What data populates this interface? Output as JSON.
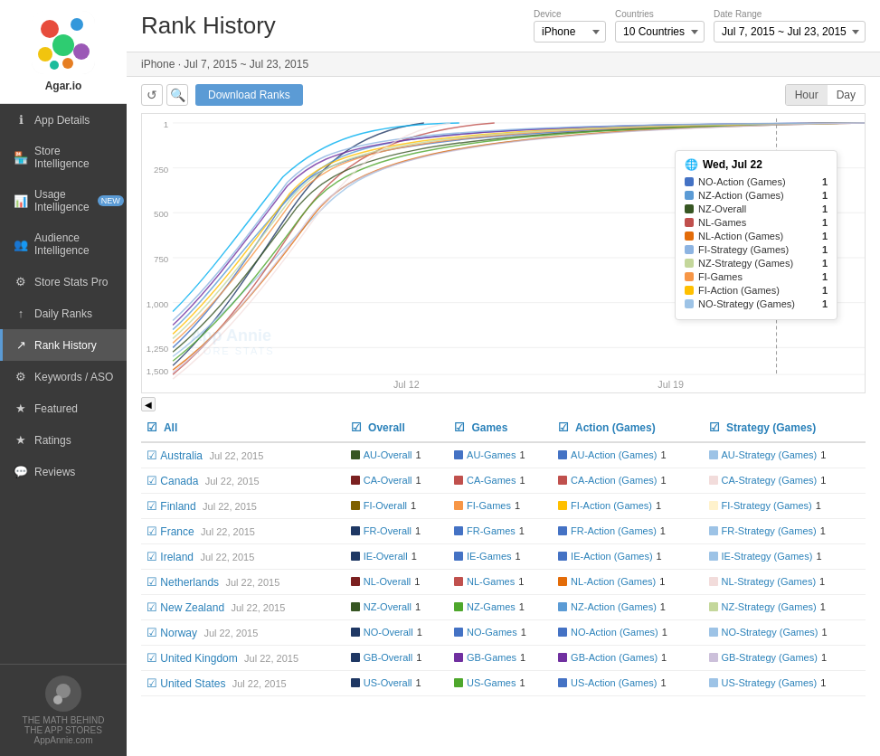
{
  "sidebar": {
    "app_name": "Agar.io",
    "nav_items": [
      {
        "id": "app-details",
        "label": "App Details",
        "icon": "ℹ",
        "badge": null,
        "active": false
      },
      {
        "id": "store-intelligence",
        "label": "Store Intelligence",
        "icon": "🏪",
        "badge": null,
        "active": false
      },
      {
        "id": "usage-intelligence",
        "label": "Usage Intelligence",
        "icon": "📊",
        "badge": "NEW",
        "active": false
      },
      {
        "id": "audience-intelligence",
        "label": "Audience Intelligence",
        "icon": "👥",
        "badge": null,
        "active": false
      },
      {
        "id": "store-stats-pro",
        "label": "Store Stats Pro",
        "icon": "⭐",
        "badge": null,
        "active": false
      },
      {
        "id": "daily-ranks",
        "label": "Daily Ranks",
        "icon": "📅",
        "badge": null,
        "active": false
      },
      {
        "id": "rank-history",
        "label": "Rank History",
        "icon": "📈",
        "badge": null,
        "active": true
      },
      {
        "id": "keywords",
        "label": "Keywords / ASO",
        "icon": "🔑",
        "badge": null,
        "active": false
      },
      {
        "id": "featured",
        "label": "Featured",
        "icon": "⭐",
        "badge": null,
        "active": false
      },
      {
        "id": "ratings",
        "label": "Ratings",
        "icon": "★",
        "badge": null,
        "active": false
      },
      {
        "id": "reviews",
        "label": "Reviews",
        "icon": "💬",
        "badge": null,
        "active": false
      }
    ],
    "footer_line1": "THE MATH BEHIND",
    "footer_line2": "THE APP STORES",
    "footer_line3": "AppAnnie.com"
  },
  "header": {
    "title": "Rank History",
    "device_label": "Device",
    "device_value": "iPhone",
    "countries_label": "Countries",
    "countries_value": "10 Countries",
    "date_label": "Date Range",
    "date_value": "Jul 7, 2015 ~ Jul 23, 2015"
  },
  "subheader": {
    "text": "iPhone · Jul 7, 2015 ~ Jul 23, 2015"
  },
  "chart": {
    "download_btn": "Download Ranks",
    "hour_btn": "Hour",
    "day_btn": "Day",
    "x_labels": [
      "Jul 12",
      "Jul 19"
    ],
    "y_labels": [
      "1",
      "250",
      "500",
      "750",
      "1,000",
      "1,250",
      "1,500"
    ],
    "tooltip": {
      "date": "Wed, Jul 22",
      "rows": [
        {
          "label": "NO-Action (Games)",
          "value": "1",
          "color": "#4472C4"
        },
        {
          "label": "NZ-Action (Games)",
          "value": "1",
          "color": "#5B9BD5"
        },
        {
          "label": "NZ-Overall",
          "value": "1",
          "color": "#375623"
        },
        {
          "label": "NL-Games",
          "value": "1",
          "color": "#C0504D"
        },
        {
          "label": "NL-Action (Games)",
          "value": "1",
          "color": "#E36C09"
        },
        {
          "label": "FI-Strategy (Games)",
          "value": "1",
          "color": "#8DB4E2"
        },
        {
          "label": "NZ-Strategy (Games)",
          "value": "1",
          "color": "#C4D79B"
        },
        {
          "label": "FI-Games",
          "value": "1",
          "color": "#F79646"
        },
        {
          "label": "FI-Action (Games)",
          "value": "1",
          "color": "#FFC000"
        },
        {
          "label": "NO-Strategy (Games)",
          "value": "1",
          "color": "#9DC3E6"
        }
      ]
    }
  },
  "table": {
    "headers": [
      "All",
      "Overall",
      "Games",
      "Action (Games)",
      "Strategy (Games)"
    ],
    "rows": [
      {
        "country": "Australia",
        "date": "Jul 22, 2015",
        "overall": {
          "label": "AU-Overall",
          "color": "#375623",
          "rank": "1"
        },
        "games": {
          "label": "AU-Games",
          "color": "#4472C4",
          "rank": "1"
        },
        "action": {
          "label": "AU-Action (Games)",
          "color": "#4472C4",
          "rank": "1"
        },
        "strategy": {
          "label": "AU-Strategy (Games)",
          "color": "#9DC3E6",
          "rank": "1"
        }
      },
      {
        "country": "Canada",
        "date": "Jul 22, 2015",
        "overall": {
          "label": "CA-Overall",
          "color": "#7B2020",
          "rank": "1"
        },
        "games": {
          "label": "CA-Games",
          "color": "#C0504D",
          "rank": "1"
        },
        "action": {
          "label": "CA-Action (Games)",
          "color": "#C0504D",
          "rank": "1"
        },
        "strategy": {
          "label": "CA-Strategy (Games)",
          "color": "#F2DCDB",
          "rank": "1"
        }
      },
      {
        "country": "Finland",
        "date": "Jul 22, 2015",
        "overall": {
          "label": "FI-Overall",
          "color": "#7F6000",
          "rank": "1"
        },
        "games": {
          "label": "FI-Games",
          "color": "#F79646",
          "rank": "1"
        },
        "action": {
          "label": "FI-Action (Games)",
          "color": "#FFC000",
          "rank": "1"
        },
        "strategy": {
          "label": "FI-Strategy (Games)",
          "color": "#FFF2CC",
          "rank": "1"
        }
      },
      {
        "country": "France",
        "date": "Jul 22, 2015",
        "overall": {
          "label": "FR-Overall",
          "color": "#1F3864",
          "rank": "1"
        },
        "games": {
          "label": "FR-Games",
          "color": "#4472C4",
          "rank": "1"
        },
        "action": {
          "label": "FR-Action (Games)",
          "color": "#4472C4",
          "rank": "1"
        },
        "strategy": {
          "label": "FR-Strategy (Games)",
          "color": "#9DC3E6",
          "rank": "1"
        }
      },
      {
        "country": "Ireland",
        "date": "Jul 22, 2015",
        "overall": {
          "label": "IE-Overall",
          "color": "#1F3864",
          "rank": "1"
        },
        "games": {
          "label": "IE-Games",
          "color": "#4472C4",
          "rank": "1"
        },
        "action": {
          "label": "IE-Action (Games)",
          "color": "#4472C4",
          "rank": "1"
        },
        "strategy": {
          "label": "IE-Strategy (Games)",
          "color": "#9DC3E6",
          "rank": "1"
        }
      },
      {
        "country": "Netherlands",
        "date": "Jul 22, 2015",
        "overall": {
          "label": "NL-Overall",
          "color": "#7B2020",
          "rank": "1"
        },
        "games": {
          "label": "NL-Games",
          "color": "#C0504D",
          "rank": "1"
        },
        "action": {
          "label": "NL-Action (Games)",
          "color": "#E36C09",
          "rank": "1"
        },
        "strategy": {
          "label": "NL-Strategy (Games)",
          "color": "#F2DCDB",
          "rank": "1"
        }
      },
      {
        "country": "New Zealand",
        "date": "Jul 22, 2015",
        "overall": {
          "label": "NZ-Overall",
          "color": "#375623",
          "rank": "1"
        },
        "games": {
          "label": "NZ-Games",
          "color": "#4EA72C",
          "rank": "1"
        },
        "action": {
          "label": "NZ-Action (Games)",
          "color": "#5B9BD5",
          "rank": "1"
        },
        "strategy": {
          "label": "NZ-Strategy (Games)",
          "color": "#C4D79B",
          "rank": "1"
        }
      },
      {
        "country": "Norway",
        "date": "Jul 22, 2015",
        "overall": {
          "label": "NO-Overall",
          "color": "#1F3864",
          "rank": "1"
        },
        "games": {
          "label": "NO-Games",
          "color": "#4472C4",
          "rank": "1"
        },
        "action": {
          "label": "NO-Action (Games)",
          "color": "#4472C4",
          "rank": "1"
        },
        "strategy": {
          "label": "NO-Strategy (Games)",
          "color": "#9DC3E6",
          "rank": "1"
        }
      },
      {
        "country": "United Kingdom",
        "date": "Jul 22, 2015",
        "overall": {
          "label": "GB-Overall",
          "color": "#1F3864",
          "rank": "1"
        },
        "games": {
          "label": "GB-Games",
          "color": "#7030A0",
          "rank": "1"
        },
        "action": {
          "label": "GB-Action (Games)",
          "color": "#7030A0",
          "rank": "1"
        },
        "strategy": {
          "label": "GB-Strategy (Games)",
          "color": "#CCC0DA",
          "rank": "1"
        }
      },
      {
        "country": "United States",
        "date": "Jul 22, 2015",
        "overall": {
          "label": "US-Overall",
          "color": "#1F3864",
          "rank": "1"
        },
        "games": {
          "label": "US-Games",
          "color": "#4EA72C",
          "rank": "1"
        },
        "action": {
          "label": "US-Action (Games)",
          "color": "#4472C4",
          "rank": "1"
        },
        "strategy": {
          "label": "US-Strategy (Games)",
          "color": "#9DC3E6",
          "rank": "1"
        }
      }
    ]
  }
}
